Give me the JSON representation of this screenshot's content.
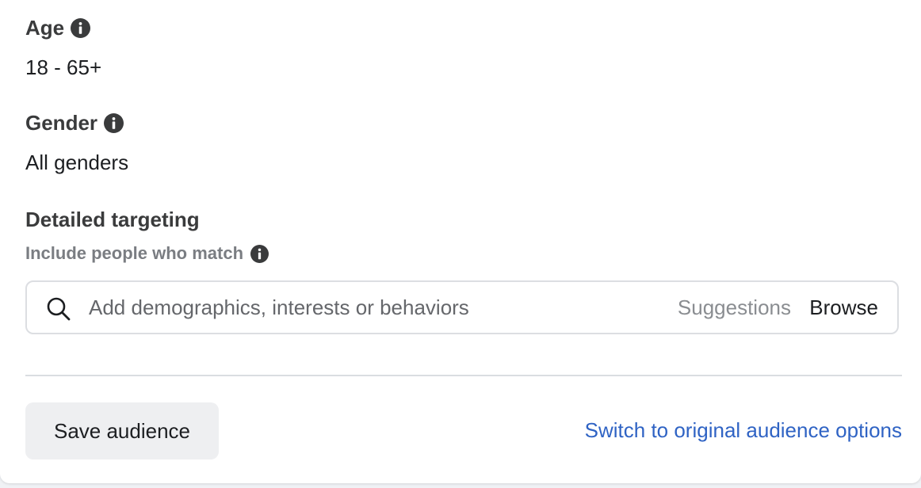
{
  "age": {
    "label": "Age",
    "value": "18 - 65+",
    "info_icon": "info-icon"
  },
  "gender": {
    "label": "Gender",
    "value": "All genders",
    "info_icon": "info-icon"
  },
  "detailed_targeting": {
    "label": "Detailed targeting",
    "sub_label": "Include people who match",
    "info_icon": "info-icon",
    "search": {
      "icon": "search-icon",
      "placeholder": "Add demographics, interests or behaviors",
      "value": "",
      "suggestions_label": "Suggestions",
      "browse_label": "Browse"
    }
  },
  "footer": {
    "save_label": "Save audience",
    "switch_label": "Switch to original audience options"
  },
  "colors": {
    "link": "#2f63c4",
    "label": "#3a3b3c",
    "muted": "#7a7d82",
    "button_bg": "#eeeff1"
  }
}
